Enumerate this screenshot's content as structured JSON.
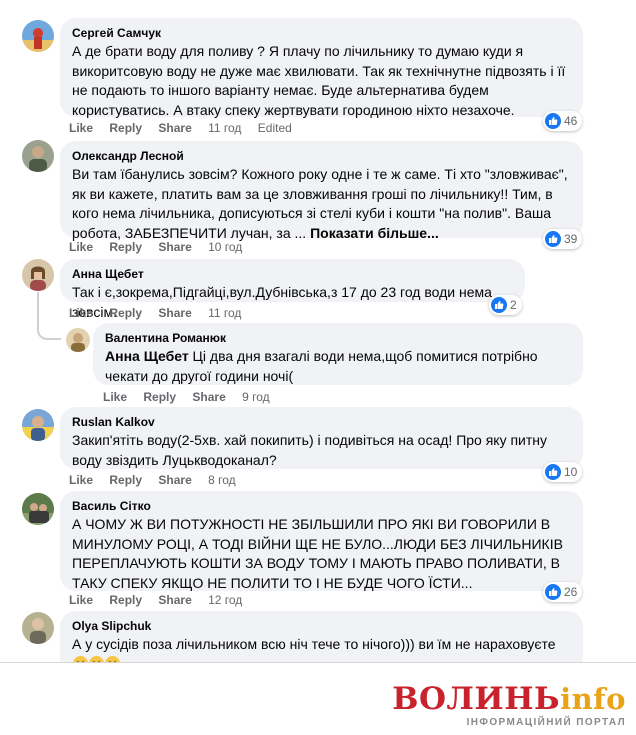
{
  "actions": {
    "like": "Like",
    "reply": "Reply",
    "share": "Share"
  },
  "comments": [
    {
      "author": "Сергей Самчук",
      "text": "А де брати воду для поливу ? Я плачу по лічильнику то думаю куди я викоритсовую воду не дуже має хвилювати. Так як технічнутне підвозять і її не подають то іншого варіанту немає. Буде альтернатива будем користуватись. А втаку спеку жертвувати городиною ніхто незахоче.",
      "time": "11 год",
      "edited": "Edited",
      "likes": "46"
    },
    {
      "author": "Олександр Лесной",
      "text": "Ви там їбанулись зовсім? Кожного року одне і те ж саме. Ті хто \"зловживає\", як ви кажете, платить вам за це зловживання гроші по лічильнику!! Тим, в кого нема лічильника, дописуються зі стелі куби і кошти \"на полив\". Ваша робота, ЗАБЕЗПЕЧИТИ лучан, за ...",
      "see_more": "Показати більше...",
      "time": "10 год",
      "likes": "39"
    },
    {
      "author": "Анна Щебет",
      "text": "Так і є,зокрема,Підгайці,вул.Дубнівська,з 17 до 23 год води нема зовсім.",
      "time": "11 год",
      "likes": "2"
    },
    {
      "author": "Валентина Романюк",
      "mention": "Анна Щебет",
      "text": " Ці два дня взагалі води нема,щоб помитися потрібно чекати до другої години ночі(",
      "time": "9 год"
    },
    {
      "author": "Ruslan Kalkov",
      "text": "Закип'ятіть воду(2-5хв. хай покипить) і подивіться на осад! Про яку питну воду звіздить Луцькводоканал?",
      "time": "8 год",
      "likes": "10"
    },
    {
      "author": "Василь Сітко",
      "text": "А ЧОМУ Ж ВИ ПОТУЖНОСТІ НЕ ЗБІЛЬШИЛИ ПРО ЯКІ ВИ ГОВОРИЛИ В МИНУЛОМУ РОЦІ, А ТОДІ ВІЙНИ ЩЕ НЕ БУЛО...ЛЮДИ БЕЗ ЛІЧИЛЬНИКІВ ПЕРЕПЛАЧУЮТЬ КОШТИ ЗА ВОДУ ТОМУ І МАЮТЬ ПРАВО ПОЛИВАТИ, В ТАКУ СПЕКУ ЯКЩО НЕ ПОЛИТИ ТО І НЕ БУДЕ ЧОГО ЇСТИ...",
      "time": "12 год",
      "likes": "26"
    },
    {
      "author": "Olya Slipchuk",
      "text": "А у сусідів поза лічильником всю ніч тече то нічого))) ви їм не нараховуєте",
      "emoji": "grinning-face"
    }
  ],
  "logo": {
    "brand_red": "ВОЛИНЬ",
    "brand_gold": "info",
    "tagline": "ІНФОРМАЦІЙНИЙ ПОРТАЛ"
  },
  "colors": {
    "bubble": "#f0f2f5",
    "like_blue": "#1877f2",
    "logo_red": "#c8232c",
    "logo_gold": "#e8a317"
  }
}
